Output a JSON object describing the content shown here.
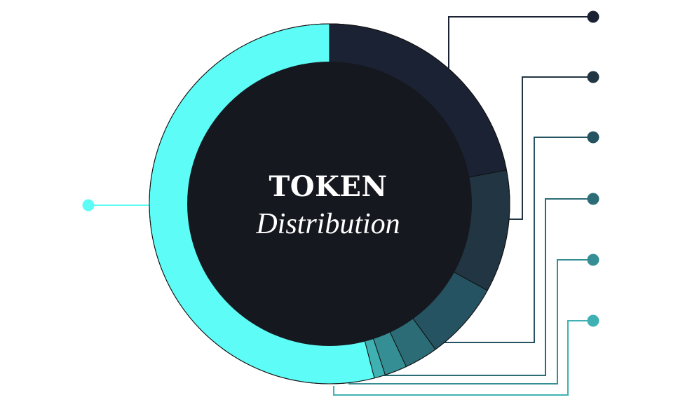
{
  "center_label": {
    "title": "TOKEN",
    "subtitle": "Distribution"
  },
  "colors": {
    "background": "#ffffff",
    "center": "#16181f",
    "text": "#ffffff",
    "outline": "#111111"
  },
  "chart_data": {
    "type": "pie",
    "style": "donut",
    "start_angle_deg": 0,
    "direction": "clockwise",
    "legend": "none",
    "series": [
      {
        "values": [
          22,
          11,
          7,
          3,
          2,
          1,
          54
        ],
        "colors": [
          "#1b2233",
          "#213642",
          "#255361",
          "#2b6c76",
          "#348e94",
          "#3fb1b2",
          "#5efcf6"
        ],
        "marker_colors": [
          "#1b2233",
          "#213642",
          "#255361",
          "#2b6c76",
          "#348e94",
          "#3fb1b2",
          "#5efcf6"
        ]
      }
    ]
  }
}
